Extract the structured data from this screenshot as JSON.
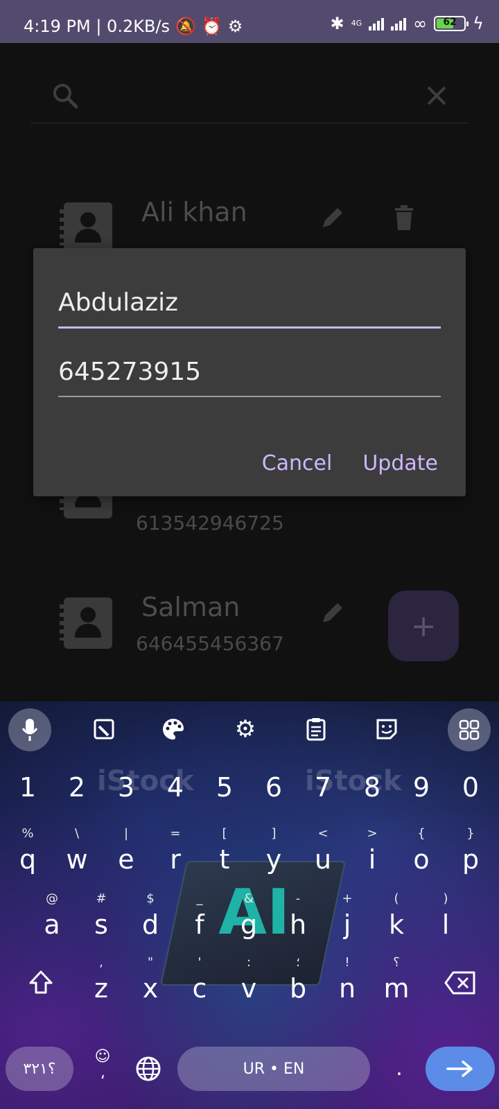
{
  "status_bar": {
    "time_net": "4:19 PM | 0.2KB/s",
    "network_type": "4G",
    "battery": "62",
    "battery_level": 0.62
  },
  "search": {
    "placeholder": ""
  },
  "contacts": [
    {
      "name": "Ali khan",
      "phone": ""
    },
    {
      "name": "",
      "phone": "613542946725"
    },
    {
      "name": "Salman",
      "phone": "646455456367"
    }
  ],
  "fab": {
    "label": "+"
  },
  "dialog": {
    "name_value": "Abdulaziz",
    "phone_value": "645273915",
    "cancel_label": "Cancel",
    "update_label": "Update",
    "accent_color": "#cdb8ff"
  },
  "keyboard": {
    "number_row": [
      "1",
      "2",
      "3",
      "4",
      "5",
      "6",
      "7",
      "8",
      "9",
      "0"
    ],
    "row1": {
      "keys": [
        "q",
        "w",
        "e",
        "r",
        "t",
        "y",
        "u",
        "i",
        "o",
        "p"
      ],
      "subs": [
        "%",
        "\\",
        "|",
        "=",
        "[",
        "]",
        "<",
        ">",
        "{",
        "}"
      ]
    },
    "row2": {
      "keys": [
        "a",
        "s",
        "d",
        "f",
        "g",
        "h",
        "j",
        "k",
        "l"
      ],
      "subs": [
        "@",
        "#",
        "$",
        "_",
        "&",
        "-",
        "+",
        "(",
        ")"
      ]
    },
    "row3": {
      "keys": [
        "z",
        "x",
        "c",
        "v",
        "b",
        "n",
        "m"
      ],
      "subs": [
        ",",
        "\"",
        "'",
        ":",
        "؛",
        "!",
        "؟"
      ]
    },
    "urdu_label": "؟٣٢١",
    "space_label": "UR • EN",
    "emoji_sub": "،",
    "period_label": ".",
    "enter_color": "#5b8de8"
  },
  "watermark": "iStock"
}
